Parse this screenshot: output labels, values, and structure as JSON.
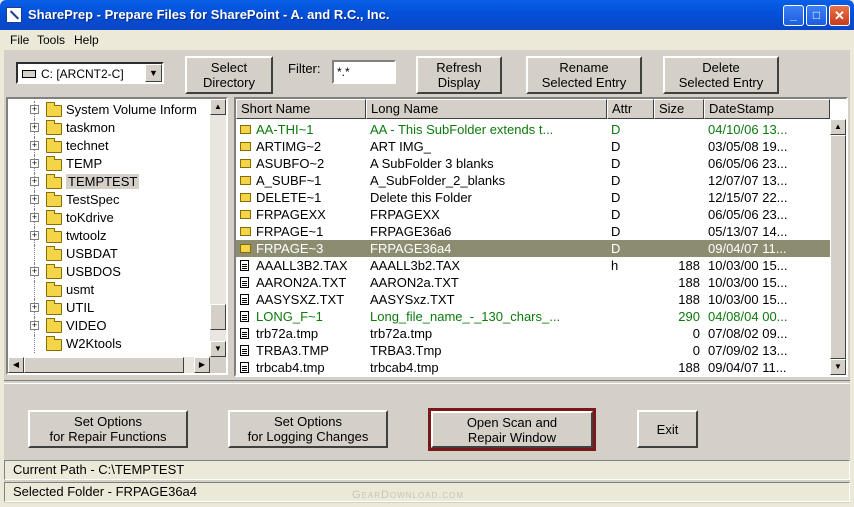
{
  "window": {
    "title": "SharePrep - Prepare Files for SharePoint - A. and R.C., Inc.",
    "minimize": "_",
    "maximize": "□",
    "close": "✕"
  },
  "menu": [
    "File",
    "Tools",
    "Help"
  ],
  "toolbar": {
    "drive": "C: [ARCNT2-C]",
    "select_directory": "Select\nDirectory",
    "filter_label": "Filter:",
    "filter_value": "*.*",
    "refresh": "Refresh\nDisplay",
    "rename": "Rename\nSelected Entry",
    "delete": "Delete\nSelected Entry"
  },
  "tree": {
    "items": [
      {
        "label": "System Volume Inform",
        "expandable": true
      },
      {
        "label": "taskmon",
        "expandable": true
      },
      {
        "label": "technet",
        "expandable": true
      },
      {
        "label": "TEMP",
        "expandable": true
      },
      {
        "label": "TEMPTEST",
        "expandable": true,
        "selected": true
      },
      {
        "label": "TestSpec",
        "expandable": true
      },
      {
        "label": "toKdrive",
        "expandable": true
      },
      {
        "label": "twtoolz",
        "expandable": true
      },
      {
        "label": "USBDAT",
        "expandable": false
      },
      {
        "label": "USBDOS",
        "expandable": true
      },
      {
        "label": "usmt",
        "expandable": false
      },
      {
        "label": "UTIL",
        "expandable": true
      },
      {
        "label": "VIDEO",
        "expandable": true
      },
      {
        "label": "W2Ktools",
        "expandable": false
      }
    ]
  },
  "list": {
    "columns": [
      "Short Name",
      "Long Name",
      "Attr",
      "Size",
      "DateStamp"
    ],
    "rows": [
      {
        "type": "folder",
        "short": "AA-THI~1",
        "long": "AA - This SubFolder extends t...",
        "attr": "D",
        "size": "",
        "date": "04/10/06 13...",
        "color": "green"
      },
      {
        "type": "folder",
        "short": "ARTIMG~2",
        "long": "ART IMG_",
        "attr": "D",
        "size": "",
        "date": "03/05/08 19..."
      },
      {
        "type": "folder",
        "short": "ASUBFO~2",
        "long": "A SubFolder 3 blanks",
        "attr": "D",
        "size": "",
        "date": "06/05/06 23..."
      },
      {
        "type": "folder",
        "short": "A_SUBF~1",
        "long": "A_SubFolder_2_blanks",
        "attr": "D",
        "size": "",
        "date": "12/07/07 13..."
      },
      {
        "type": "folder",
        "short": "DELETE~1",
        "long": "Delete this Folder",
        "attr": "D",
        "size": "",
        "date": "12/15/07 22..."
      },
      {
        "type": "folder",
        "short": "FRPAGEXX",
        "long": "FRPAGEXX",
        "attr": "D",
        "size": "",
        "date": "06/05/06 23..."
      },
      {
        "type": "folder",
        "short": "FRPAGE~1",
        "long": "FRPAGE36a6",
        "attr": "D",
        "size": "",
        "date": "05/13/07 14..."
      },
      {
        "type": "folder",
        "short": "FRPAGE~3",
        "long": "FRPAGE36a4",
        "attr": "D",
        "size": "",
        "date": "09/04/07 11...",
        "selected": true
      },
      {
        "type": "file",
        "short": "AAALL3B2.TAX",
        "long": "AAALL3b2.TAX",
        "attr": "h",
        "size": "188",
        "date": "10/03/00 15..."
      },
      {
        "type": "file",
        "short": "AARON2A.TXT",
        "long": "AARON2a.TXT",
        "attr": "",
        "size": "188",
        "date": "10/03/00 15..."
      },
      {
        "type": "file",
        "short": "AASYSXZ.TXT",
        "long": "AASYSxz.TXT",
        "attr": "",
        "size": "188",
        "date": "10/03/00 15..."
      },
      {
        "type": "file",
        "short": "LONG_F~1",
        "long": "Long_file_name_-_130_chars_...",
        "attr": "",
        "size": "290",
        "date": "04/08/04 00...",
        "color": "green"
      },
      {
        "type": "file",
        "short": "trb72a.tmp",
        "long": "trb72a.tmp",
        "attr": "",
        "size": "0",
        "date": "07/08/02 09..."
      },
      {
        "type": "file",
        "short": "TRBA3.TMP",
        "long": "TRBA3.Tmp",
        "attr": "",
        "size": "0",
        "date": "07/09/02 13..."
      },
      {
        "type": "file",
        "short": "trbcab4.tmp",
        "long": "trbcab4.tmp",
        "attr": "",
        "size": "188",
        "date": "09/04/07 11..."
      }
    ]
  },
  "actions": {
    "repair_options": "Set Options\nfor Repair Functions",
    "logging_options": "Set Options\nfor Logging Changes",
    "open_scan": "Open Scan and\nRepair Window",
    "exit": "Exit"
  },
  "status": {
    "current_path": "Current Path - C:\\TEMPTEST",
    "selected_folder": "Selected Folder  -  FRPAGE36a4"
  },
  "watermark": "GearDownload.com",
  "colors": {
    "title_bar": "#0350d8",
    "green_text": "#0b7a0b",
    "selection": "#8c8c70",
    "focus_border": "#7a1818"
  }
}
